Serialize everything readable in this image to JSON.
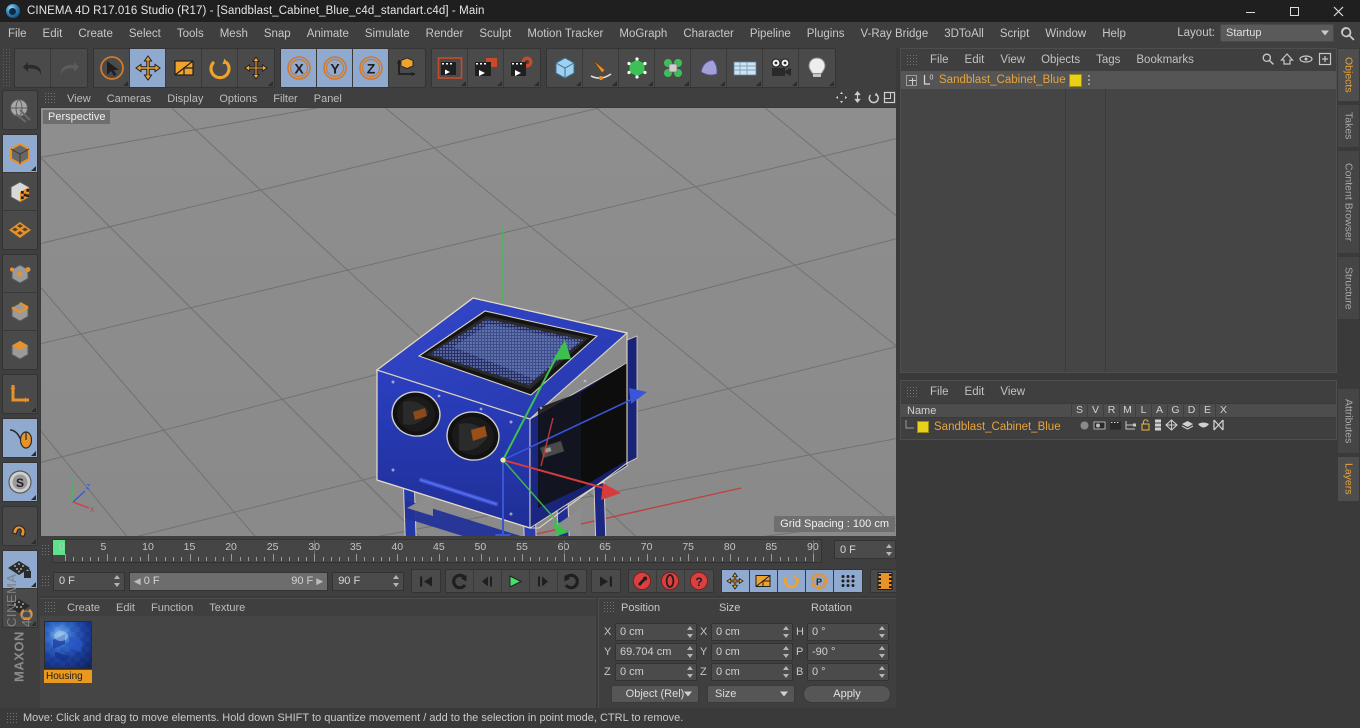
{
  "window": {
    "title": "CINEMA 4D R17.016 Studio (R17) - [Sandblast_Cabinet_Blue_c4d_standart.c4d] - Main",
    "app_icon": "cinema4d-logo-icon",
    "minimize": "minimize-icon",
    "maximize": "maximize-icon",
    "close": "close-icon"
  },
  "menubar": {
    "items": [
      "File",
      "Edit",
      "Create",
      "Select",
      "Tools",
      "Mesh",
      "Snap",
      "Animate",
      "Simulate",
      "Render",
      "Sculpt",
      "Motion Tracker",
      "MoGraph",
      "Character",
      "Pipeline",
      "Plugins",
      "V-Ray Bridge",
      "3DToAll",
      "Script",
      "Window",
      "Help"
    ],
    "layout_label": "Layout:",
    "layout_value": "Startup"
  },
  "toolbar": {
    "groups": [
      {
        "buttons": [
          {
            "name": "undo-button",
            "selected": false,
            "dim": false
          },
          {
            "name": "redo-button",
            "selected": false,
            "dim": true
          }
        ]
      },
      {
        "buttons": [
          {
            "name": "live-selection-tool",
            "selected": false,
            "dim": false
          },
          {
            "name": "move-tool",
            "selected": true,
            "dim": false
          },
          {
            "name": "scale-tool",
            "selected": false,
            "dim": false
          },
          {
            "name": "rotate-tool",
            "selected": false,
            "dim": false
          },
          {
            "name": "move-alt-tool",
            "selected": false,
            "dim": false
          }
        ]
      },
      {
        "buttons": [
          {
            "name": "lock-x-axis-button",
            "selected": true,
            "dim": false
          },
          {
            "name": "lock-y-axis-button",
            "selected": true,
            "dim": false
          },
          {
            "name": "lock-z-axis-button",
            "selected": true,
            "dim": false
          },
          {
            "name": "world-object-coordinates-button",
            "selected": false,
            "dim": false
          }
        ]
      },
      {
        "buttons": [
          {
            "name": "render-view-button",
            "selected": false,
            "dim": false
          },
          {
            "name": "render-region-button",
            "selected": false,
            "dim": false
          },
          {
            "name": "render-to-picture-viewer-button",
            "selected": false,
            "dim": false
          },
          {
            "name": "render-settings-button",
            "selected": false,
            "dim": false
          }
        ]
      },
      {
        "buttons": [
          {
            "name": "add-cube-button",
            "selected": false,
            "dim": false
          },
          {
            "name": "add-spline-button",
            "selected": false,
            "dim": false
          },
          {
            "name": "add-generator-button",
            "selected": false,
            "dim": false
          },
          {
            "name": "add-deformer-button",
            "selected": false,
            "dim": false
          },
          {
            "name": "add-scene-object-button",
            "selected": false,
            "dim": false
          },
          {
            "name": "add-environment-button",
            "selected": false,
            "dim": false
          },
          {
            "name": "add-camera-button",
            "selected": false,
            "dim": false
          },
          {
            "name": "add-light-button",
            "selected": false,
            "dim": false
          }
        ]
      }
    ]
  },
  "left_palette": {
    "groups": [
      {
        "buttons": [
          {
            "name": "make-editable-button",
            "selected": false
          }
        ]
      },
      {
        "buttons": [
          {
            "name": "model-mode-button",
            "selected": true
          },
          {
            "name": "texture-mode-button",
            "selected": false
          },
          {
            "name": "polygon-mode-button",
            "selected": false
          }
        ]
      },
      {
        "buttons": [
          {
            "name": "point-mode-button",
            "selected": false
          },
          {
            "name": "edge-mode-button",
            "selected": false
          },
          {
            "name": "polygon-select-mode-button",
            "selected": false
          }
        ]
      },
      {
        "buttons": [
          {
            "name": "object-axis-mode-button",
            "selected": false
          }
        ]
      },
      {
        "buttons": [
          {
            "name": "enable-axis-modification-button",
            "selected": true
          }
        ]
      },
      {
        "buttons": [
          {
            "name": "soft-selection-button",
            "selected": true
          }
        ]
      },
      {
        "buttons": [
          {
            "name": "snap-magnet-button",
            "selected": false
          }
        ]
      },
      {
        "buttons": [
          {
            "name": "lock-workplane-button",
            "selected": true
          },
          {
            "name": "workplane-rotate-button",
            "selected": false
          }
        ]
      }
    ],
    "brand_bold": "MAXON",
    "brand_thin": "CINEMA 4D"
  },
  "viewport": {
    "menu_items": [
      "View",
      "Cameras",
      "Display",
      "Options",
      "Filter",
      "Panel"
    ],
    "label": "Perspective",
    "grid_spacing": "Grid Spacing : 100 cm",
    "corner_icons": [
      "pan-view-icon",
      "dolly-view-icon",
      "rotate-view-icon",
      "maximize-view-icon"
    ],
    "axis_gizmo": {
      "x": "X",
      "y": "Y",
      "z": "Z"
    }
  },
  "timeline": {
    "ticks": [
      0,
      5,
      10,
      15,
      20,
      25,
      30,
      35,
      40,
      45,
      50,
      55,
      60,
      65,
      70,
      75,
      80,
      85,
      90
    ],
    "start": 0,
    "end": 90,
    "current_frame_field": "0 F",
    "playhead_frame": 0
  },
  "playback": {
    "current_frame": "0 F",
    "range_start": "0 F",
    "range_end": "90 F",
    "preview_end": "90 F",
    "transport": [
      {
        "name": "go-to-start-button",
        "selected": false
      },
      {
        "name": "play-reverse-button",
        "selected": false
      },
      {
        "name": "previous-frame-button",
        "selected": false
      },
      {
        "name": "play-forward-button",
        "selected": false
      },
      {
        "name": "next-frame-button",
        "selected": false
      },
      {
        "name": "loop-playback-button",
        "selected": false
      },
      {
        "name": "go-to-end-button",
        "selected": false
      }
    ],
    "key_buttons": [
      {
        "name": "record-active-objects-button",
        "selected": false
      },
      {
        "name": "autokeying-button",
        "selected": false
      },
      {
        "name": "keyframe-selection-button",
        "selected": false
      }
    ],
    "key_toggles": [
      {
        "name": "key-position-button",
        "selected": true
      },
      {
        "name": "key-scale-button",
        "selected": true
      },
      {
        "name": "key-rotation-button",
        "selected": true
      },
      {
        "name": "key-parameter-button",
        "selected": true
      },
      {
        "name": "key-point-level-animation-button",
        "selected": true
      }
    ],
    "timeline_toggle": {
      "name": "animation-mode-button",
      "selected": false
    }
  },
  "material_manager": {
    "menu_items": [
      "Create",
      "Edit",
      "Function",
      "Texture"
    ],
    "materials": [
      {
        "name": "Housing",
        "swatch": "blue-sphere-preview"
      }
    ]
  },
  "coordinates": {
    "columns": [
      "Position",
      "Size",
      "Rotation"
    ],
    "position": {
      "x": "0 cm",
      "y": "69.704 cm",
      "z": "0 cm"
    },
    "size": {
      "x": "0 cm",
      "y": "0 cm",
      "z": "0 cm"
    },
    "rotation": {
      "h": "0 °",
      "p": "-90 °",
      "b": "0 °"
    },
    "axis_labels": {
      "pos": [
        "X",
        "Y",
        "Z"
      ],
      "size": [
        "X",
        "Y",
        "Z"
      ],
      "rot": [
        "H",
        "P",
        "B"
      ]
    },
    "mode_dropdown": "Object (Rel)",
    "size_dropdown": "Size",
    "apply_label": "Apply"
  },
  "object_manager": {
    "menu_items": [
      "File",
      "Edit",
      "View",
      "Objects",
      "Tags",
      "Bookmarks"
    ],
    "header_icons": [
      "search-icon",
      "home-icon",
      "eye-icon",
      "add-layer-icon"
    ],
    "objects": [
      {
        "name": "Sandblast_Cabinet_Blue",
        "icon": "null-object-icon",
        "tag_color": "#e8d118",
        "expandable": true
      }
    ]
  },
  "layer_manager": {
    "menu_items": [
      "File",
      "Edit",
      "View"
    ],
    "columns": [
      "Name",
      "S",
      "V",
      "R",
      "M",
      "L",
      "A",
      "G",
      "D",
      "E",
      "X"
    ],
    "rows": [
      {
        "name": "Sandblast_Cabinet_Blue",
        "swatch": "#e8d118"
      }
    ]
  },
  "right_tabs": [
    {
      "label": "Objects",
      "active": true
    },
    {
      "label": "Takes",
      "active": false
    },
    {
      "label": "Content Browser",
      "active": false
    },
    {
      "label": "Structure",
      "active": false
    },
    {
      "label": "Attributes",
      "active": false
    },
    {
      "label": "Layers",
      "active": true
    }
  ],
  "statusbar": {
    "message": "Move: Click and drag to move elements. Hold down SHIFT to quantize movement / add to the selection in point mode, CTRL to remove."
  },
  "colors": {
    "accent_orange": "#e8a33d",
    "selection_blue": "#8fa9cf",
    "panel_bg": "#3f3f3f",
    "field_bg": "#4b4b4b",
    "model_blue": "#2438b0",
    "axis_x": "#e03030",
    "axis_y": "#35c040",
    "axis_z": "#3050e0",
    "playhead_green": "#5fe08a"
  }
}
